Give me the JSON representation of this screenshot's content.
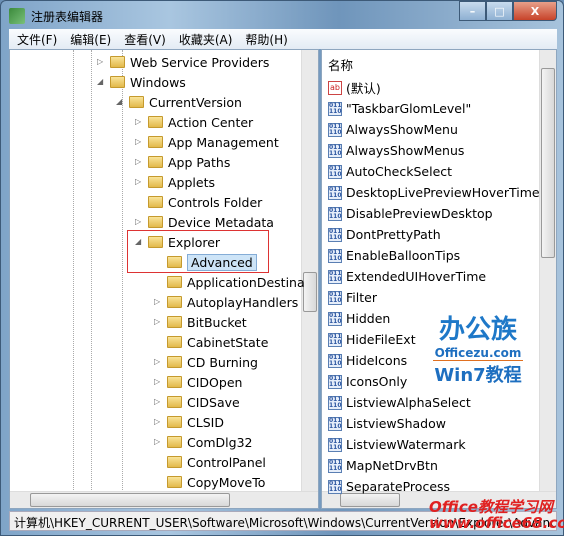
{
  "window": {
    "title": "注册表编辑器",
    "min": "–",
    "max": "□",
    "close": "X"
  },
  "menu": [
    "文件(F)",
    "编辑(E)",
    "查看(V)",
    "收藏夹(A)",
    "帮助(H)"
  ],
  "tree": [
    {
      "label": "Web Service Providers",
      "level": 0,
      "arrow": "▷"
    },
    {
      "label": "Windows",
      "level": 0,
      "arrow": "◢"
    },
    {
      "label": "CurrentVersion",
      "level": 1,
      "arrow": "◢"
    },
    {
      "label": "Action Center",
      "level": 2,
      "arrow": "▷"
    },
    {
      "label": "App Management",
      "level": 2,
      "arrow": "▷"
    },
    {
      "label": "App Paths",
      "level": 2,
      "arrow": "▷"
    },
    {
      "label": "Applets",
      "level": 2,
      "arrow": "▷"
    },
    {
      "label": "Controls Folder",
      "level": 2,
      "arrow": ""
    },
    {
      "label": "Device Metadata",
      "level": 2,
      "arrow": "▷"
    },
    {
      "label": "Explorer",
      "level": 2,
      "arrow": "◢"
    },
    {
      "label": "Advanced",
      "level": 3,
      "arrow": "",
      "selected": true
    },
    {
      "label": "ApplicationDestina",
      "level": 3,
      "arrow": ""
    },
    {
      "label": "AutoplayHandlers",
      "level": 3,
      "arrow": "▷"
    },
    {
      "label": "BitBucket",
      "level": 3,
      "arrow": "▷"
    },
    {
      "label": "CabinetState",
      "level": 3,
      "arrow": ""
    },
    {
      "label": "CD Burning",
      "level": 3,
      "arrow": "▷"
    },
    {
      "label": "CIDOpen",
      "level": 3,
      "arrow": "▷"
    },
    {
      "label": "CIDSave",
      "level": 3,
      "arrow": "▷"
    },
    {
      "label": "CLSID",
      "level": 3,
      "arrow": "▷"
    },
    {
      "label": "ComDlg32",
      "level": 3,
      "arrow": "▷"
    },
    {
      "label": "ControlPanel",
      "level": 3,
      "arrow": ""
    },
    {
      "label": "CopyMoveTo",
      "level": 3,
      "arrow": ""
    }
  ],
  "list": {
    "header": "名称",
    "items": [
      {
        "label": "(默认)",
        "icon": "ab"
      },
      {
        "label": "\"TaskbarGlomLevel\"",
        "icon": "bin"
      },
      {
        "label": "AlwaysShowMenu",
        "icon": "bin"
      },
      {
        "label": "AlwaysShowMenus",
        "icon": "bin"
      },
      {
        "label": "AutoCheckSelect",
        "icon": "bin"
      },
      {
        "label": "DesktopLivePreviewHoverTime",
        "icon": "bin"
      },
      {
        "label": "DisablePreviewDesktop",
        "icon": "bin"
      },
      {
        "label": "DontPrettyPath",
        "icon": "bin"
      },
      {
        "label": "EnableBalloonTips",
        "icon": "bin"
      },
      {
        "label": "ExtendedUIHoverTime",
        "icon": "bin"
      },
      {
        "label": "Filter",
        "icon": "bin"
      },
      {
        "label": "Hidden",
        "icon": "bin"
      },
      {
        "label": "HideFileExt",
        "icon": "bin"
      },
      {
        "label": "HideIcons",
        "icon": "bin"
      },
      {
        "label": "IconsOnly",
        "icon": "bin"
      },
      {
        "label": "ListviewAlphaSelect",
        "icon": "bin"
      },
      {
        "label": "ListviewShadow",
        "icon": "bin"
      },
      {
        "label": "ListviewWatermark",
        "icon": "bin"
      },
      {
        "label": "MapNetDrvBtn",
        "icon": "bin"
      },
      {
        "label": "SeparateProcess",
        "icon": "bin"
      }
    ]
  },
  "status": "计算机\\HKEY_CURRENT_USER\\Software\\Microsoft\\Windows\\CurrentVersion\\Explorer\\Advanced",
  "watermark1": {
    "a": "办公族",
    "b": "Officezu.com",
    "c": "Win7教程"
  },
  "watermark2": {
    "a": "Office教程学习网",
    "b": "www.office68.com"
  }
}
